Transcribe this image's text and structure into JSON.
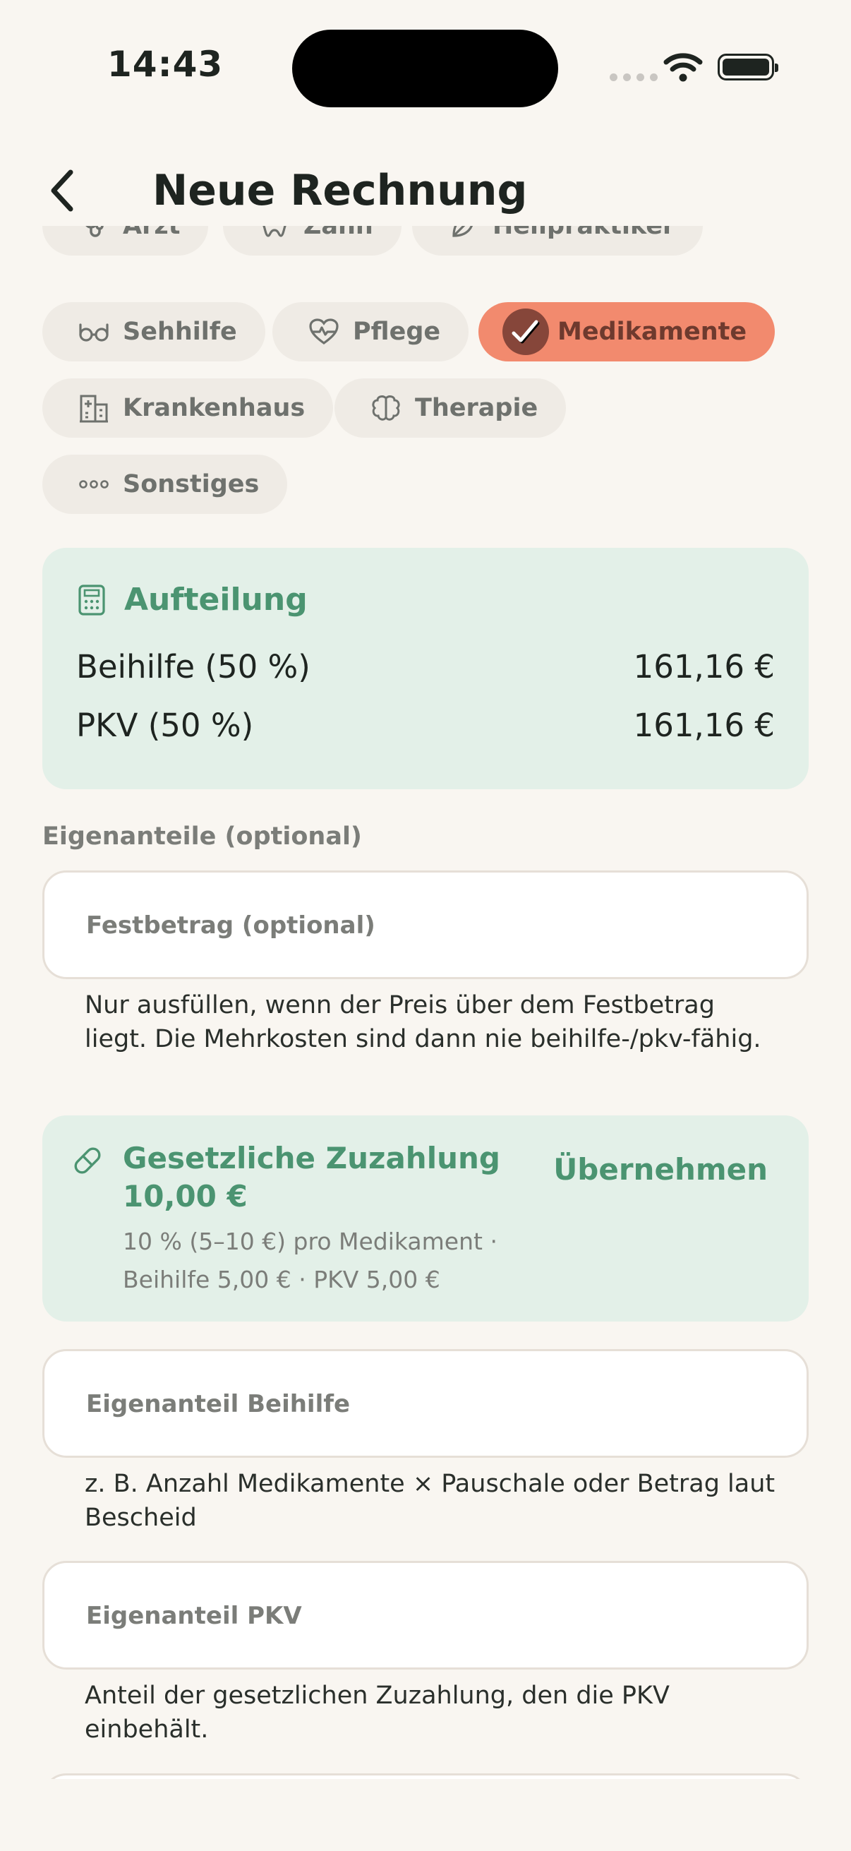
{
  "status": {
    "time": "14:43"
  },
  "header": {
    "title": "Neue Rechnung"
  },
  "categories": [
    {
      "label": "Arzt",
      "icon": "stethoscope-icon"
    },
    {
      "label": "Zahn",
      "icon": "tooth-icon"
    },
    {
      "label": "Heilpraktiker",
      "icon": "leaf-icon"
    },
    {
      "label": "Sehhilfe",
      "icon": "glasses-icon"
    },
    {
      "label": "Pflege",
      "icon": "heart-pulse-icon"
    },
    {
      "label": "Medikamente",
      "icon": "check-icon",
      "selected": true
    },
    {
      "label": "Krankenhaus",
      "icon": "hospital-icon"
    },
    {
      "label": "Therapie",
      "icon": "brain-icon"
    },
    {
      "label": "Sonstiges",
      "icon": "more-dots-icon"
    }
  ],
  "split": {
    "title": "Aufteilung",
    "rows": [
      {
        "label": "Beihilfe (50 %)",
        "amount": "161,16 €"
      },
      {
        "label": "PKV (50 %)",
        "amount": "161,16 €"
      }
    ]
  },
  "own_share": {
    "section_label": "Eigenanteile (optional)",
    "festbetrag": {
      "placeholder": "Festbetrag (optional)",
      "value": "",
      "hint": "Nur ausfüllen, wenn der Preis über dem Festbetrag liegt. Die Mehrkosten sind dann nie beihilfe-/pkv-fähig."
    },
    "zuzahlung": {
      "title": "Gesetzliche Zuzahlung 10,00 €",
      "subtitle": "10 % (5–10 €) pro Medikament · Beihilfe 5,00 € · PKV 5,00 €",
      "action_label": "Übernehmen"
    },
    "beihilfe": {
      "placeholder": "Eigenanteil Beihilfe",
      "value": "",
      "hint": "z. B. Anzahl Medikamente × Pauschale oder Betrag laut Bescheid"
    },
    "pkv": {
      "placeholder": "Eigenanteil PKV",
      "value": "",
      "hint": "Anteil der gesetzlichen Zuzahlung, den die PKV einbehält."
    }
  },
  "colors": {
    "background": "#F9F6F1",
    "accent_green": "#4B9471",
    "card_green": "#E3F0E8",
    "chip_selected": "#F28A6E",
    "chip_default": "#EFEBE5"
  }
}
